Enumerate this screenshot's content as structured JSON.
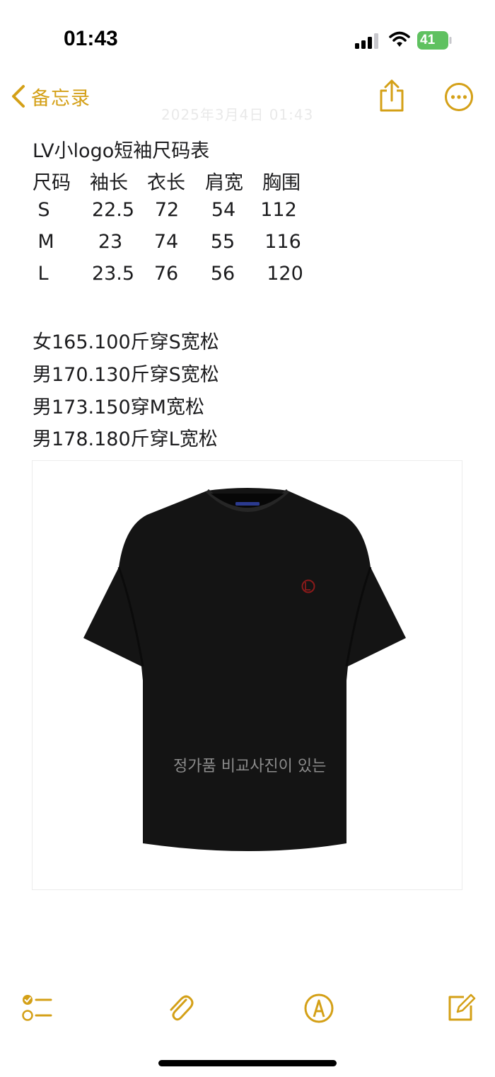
{
  "status_bar": {
    "time": "01:43",
    "battery_level": "41"
  },
  "nav": {
    "back_label": "备忘录",
    "faded_title": "2025年3月4日 01:43"
  },
  "note": {
    "title": "LV小logo短袖尺码表",
    "table": {
      "headers": [
        "尺码",
        "袖长",
        "衣长",
        "肩宽",
        "胸围"
      ],
      "rows": [
        [
          "S",
          "22.5",
          "72",
          "54",
          "112"
        ],
        [
          "M",
          "23",
          "74",
          "55",
          "116"
        ],
        [
          "L",
          "23.5",
          "76",
          "56",
          "120"
        ]
      ]
    },
    "recommendations": [
      "女165.100斤穿S宽松",
      "男170.130斤穿S宽松",
      "男173.150穿M宽松",
      "男178.180斤穿L宽松"
    ]
  },
  "image": {
    "subject": "black-tshirt",
    "watermark_text": "정가품 비교사진이 있는"
  },
  "toolbar": {
    "items": [
      "checklist-icon",
      "attachment-icon",
      "markup-icon",
      "compose-icon"
    ]
  },
  "colors": {
    "accent": "#d4a017",
    "text": "#1c1c1e",
    "shirt": "#141414",
    "logo": "#8b1a1a"
  }
}
